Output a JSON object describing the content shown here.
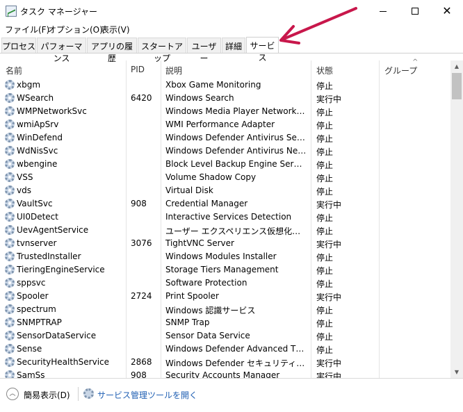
{
  "window": {
    "title": "タスク マネージャー",
    "minimize": "",
    "maximize": "",
    "close": "✕"
  },
  "menu": [
    "ファイル(F)",
    "オプション(O)",
    "表示(V)"
  ],
  "tabs": [
    "プロセス",
    "パフォーマンス",
    "アプリの履歴",
    "スタートアップ",
    "ユーザー",
    "詳細",
    "サービス"
  ],
  "active_tab": "サービス",
  "columns": {
    "name": "名前",
    "pid": "PID",
    "description": "説明",
    "status": "状態",
    "group": "グループ"
  },
  "services": [
    {
      "name": "xbgm",
      "pid": "",
      "description": "Xbox Game Monitoring",
      "status": "停止"
    },
    {
      "name": "WSearch",
      "pid": "6420",
      "description": "Windows Search",
      "status": "実行中"
    },
    {
      "name": "WMPNetworkSvc",
      "pid": "",
      "description": "Windows Media Player Network Sha...",
      "status": "停止"
    },
    {
      "name": "wmiApSrv",
      "pid": "",
      "description": "WMI Performance Adapter",
      "status": "停止"
    },
    {
      "name": "WinDefend",
      "pid": "",
      "description": "Windows Defender Antivirus Service",
      "status": "停止"
    },
    {
      "name": "WdNisSvc",
      "pid": "",
      "description": "Windows Defender Antivirus Networ...",
      "status": "停止"
    },
    {
      "name": "wbengine",
      "pid": "",
      "description": "Block Level Backup Engine Service",
      "status": "停止"
    },
    {
      "name": "VSS",
      "pid": "",
      "description": "Volume Shadow Copy",
      "status": "停止"
    },
    {
      "name": "vds",
      "pid": "",
      "description": "Virtual Disk",
      "status": "停止"
    },
    {
      "name": "VaultSvc",
      "pid": "908",
      "description": "Credential Manager",
      "status": "実行中"
    },
    {
      "name": "UI0Detect",
      "pid": "",
      "description": "Interactive Services Detection",
      "status": "停止"
    },
    {
      "name": "UevAgentService",
      "pid": "",
      "description": "ユーザー エクスペリエンス仮想化サービス",
      "status": "停止"
    },
    {
      "name": "tvnserver",
      "pid": "3076",
      "description": "TightVNC Server",
      "status": "実行中"
    },
    {
      "name": "TrustedInstaller",
      "pid": "",
      "description": "Windows Modules Installer",
      "status": "停止"
    },
    {
      "name": "TieringEngineService",
      "pid": "",
      "description": "Storage Tiers Management",
      "status": "停止"
    },
    {
      "name": "sppsvc",
      "pid": "",
      "description": "Software Protection",
      "status": "停止"
    },
    {
      "name": "Spooler",
      "pid": "2724",
      "description": "Print Spooler",
      "status": "実行中"
    },
    {
      "name": "spectrum",
      "pid": "",
      "description": "Windows 認識サービス",
      "status": "停止"
    },
    {
      "name": "SNMPTRAP",
      "pid": "",
      "description": "SNMP Trap",
      "status": "停止"
    },
    {
      "name": "SensorDataService",
      "pid": "",
      "description": "Sensor Data Service",
      "status": "停止"
    },
    {
      "name": "Sense",
      "pid": "",
      "description": "Windows Defender Advanced Threat...",
      "status": "停止"
    },
    {
      "name": "SecurityHealthService",
      "pid": "2868",
      "description": "Windows Defender セキュリティ センター...",
      "status": "実行中"
    },
    {
      "name": "SamSs",
      "pid": "908",
      "description": "Security Accounts Manager",
      "status": "実行中"
    }
  ],
  "footer": {
    "fewer_details": "簡易表示(D)",
    "open_services": "サービス管理ツールを開く"
  },
  "colors": {
    "link": "#1f5fb3",
    "arrow": "#c8174b"
  }
}
